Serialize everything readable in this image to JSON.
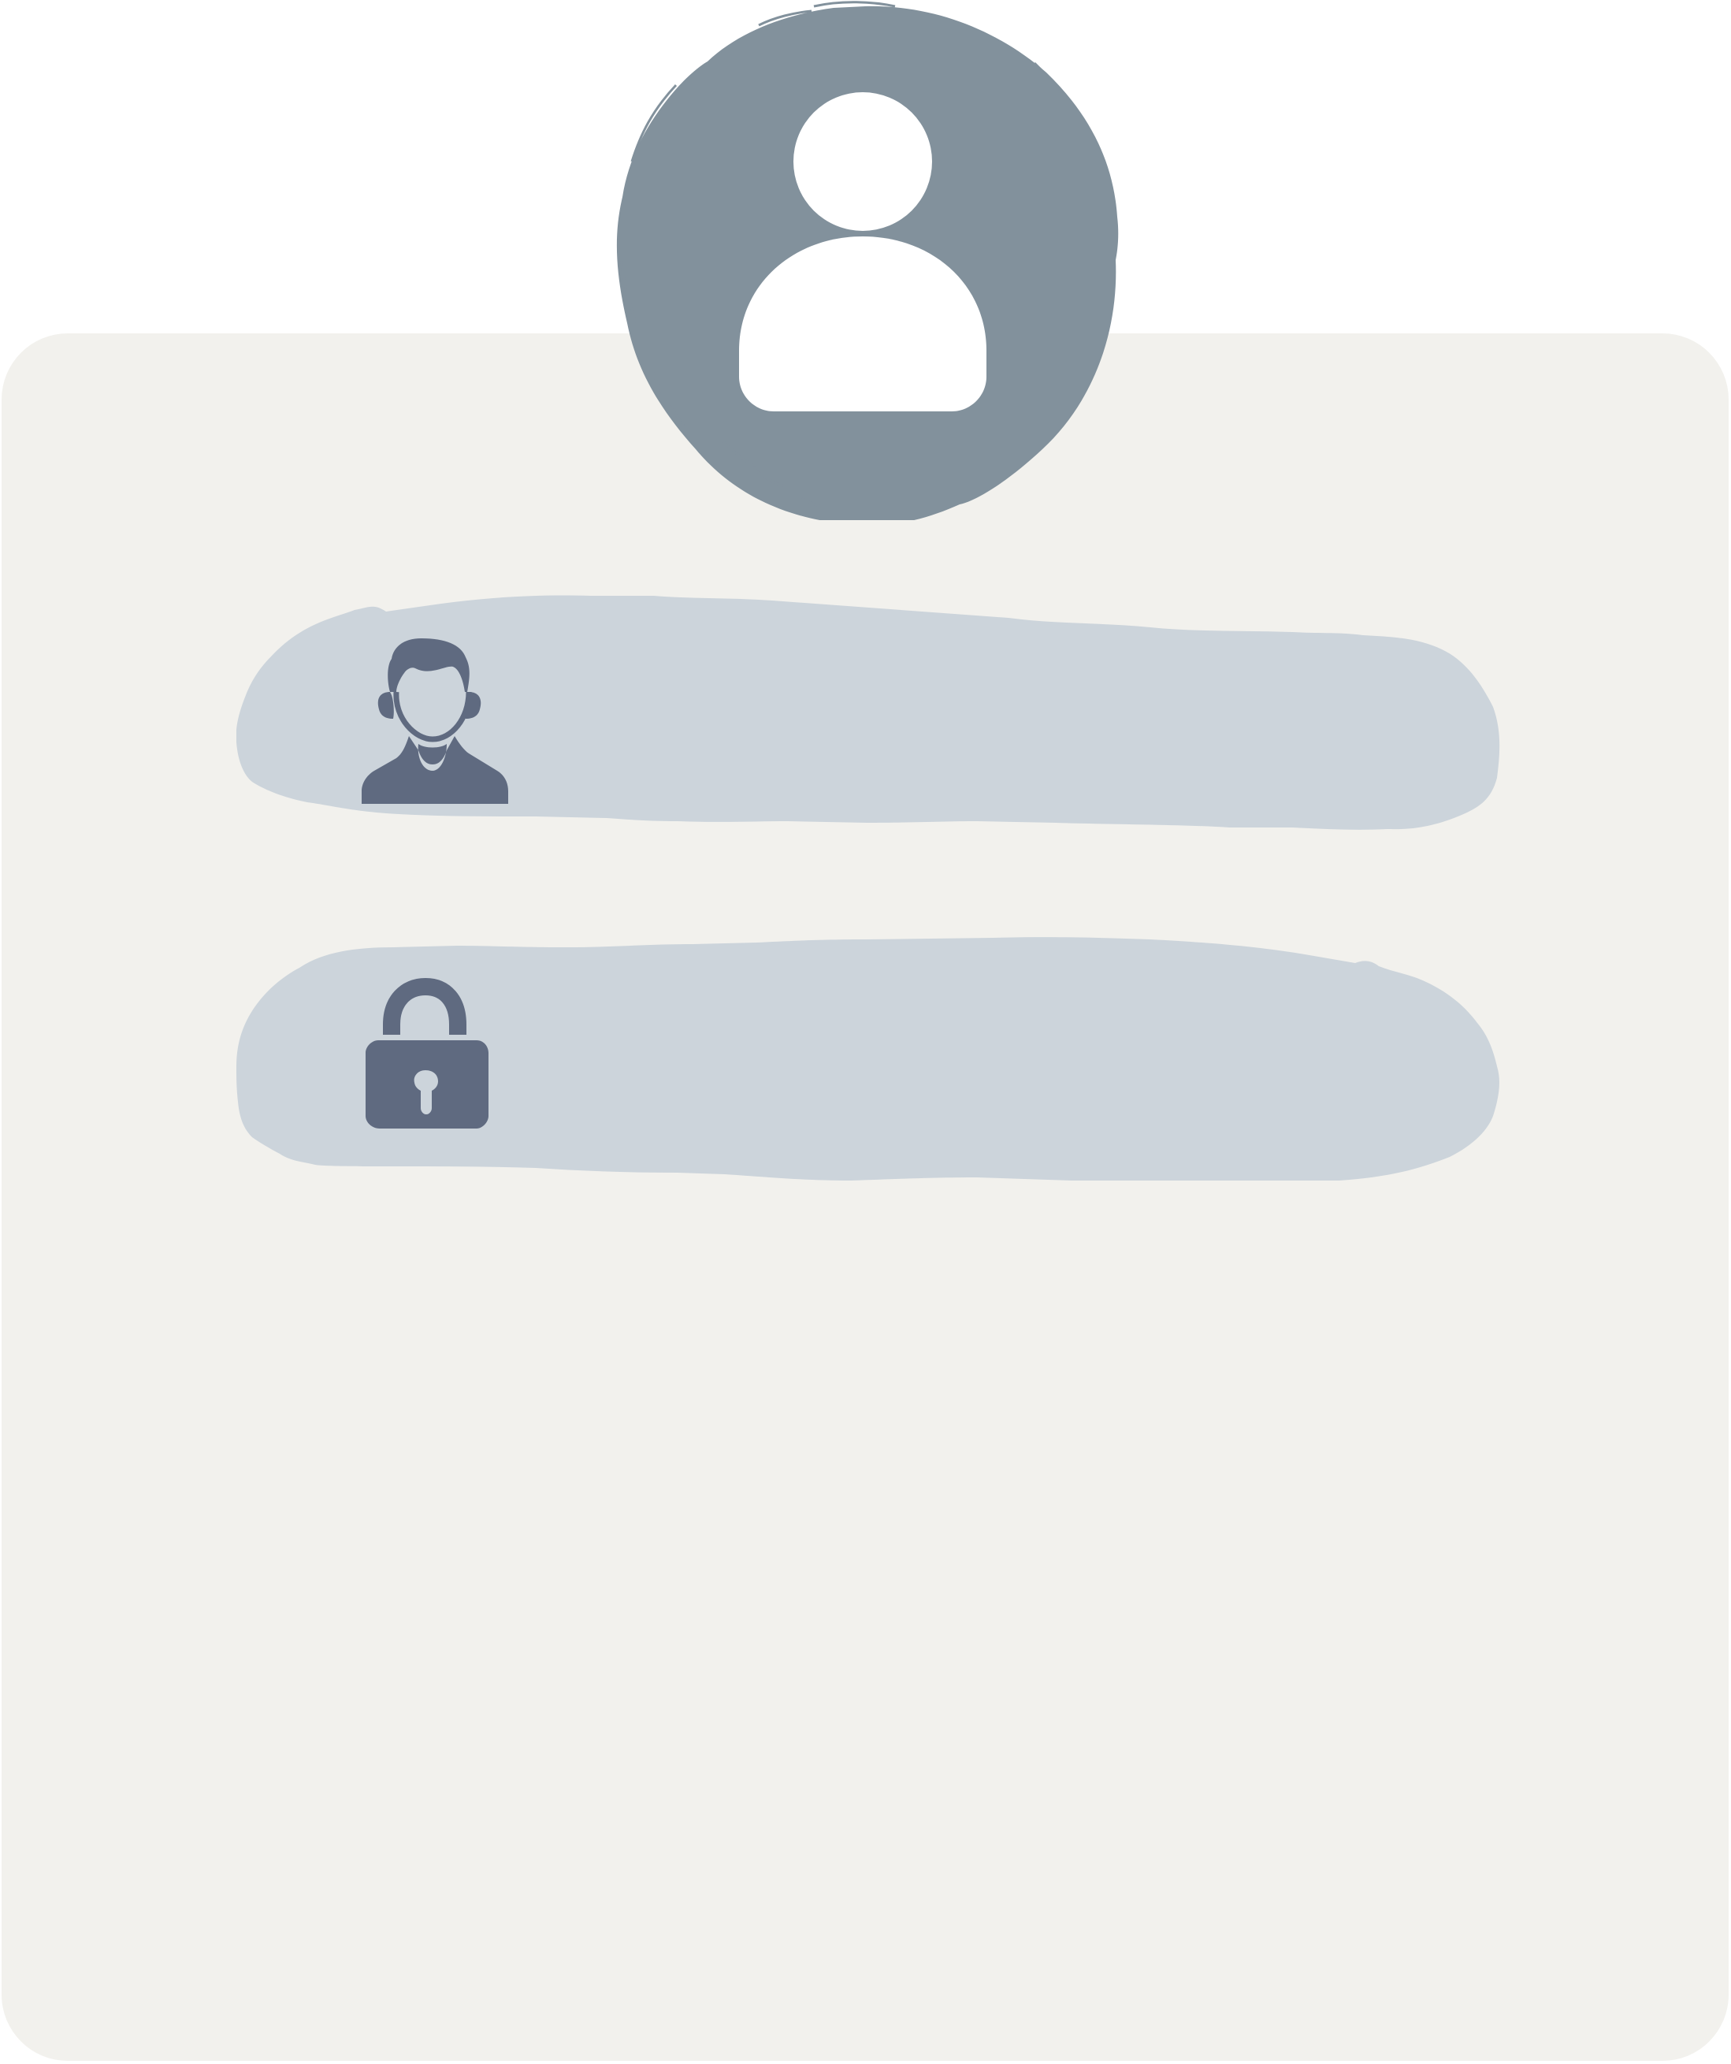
{
  "colors": {
    "page_background": "#ffffff",
    "card_background": "#f2f1ed",
    "avatar_circle": "#82919c",
    "avatar_figure": "#ffffff",
    "field_background": "#ccd4db",
    "icon_color": "#5f6a80"
  },
  "avatar": {
    "icon": "user-avatar-icon"
  },
  "form": {
    "username": {
      "icon": "user-icon",
      "value": "",
      "placeholder": ""
    },
    "password": {
      "icon": "lock-icon",
      "value": "",
      "placeholder": ""
    }
  }
}
